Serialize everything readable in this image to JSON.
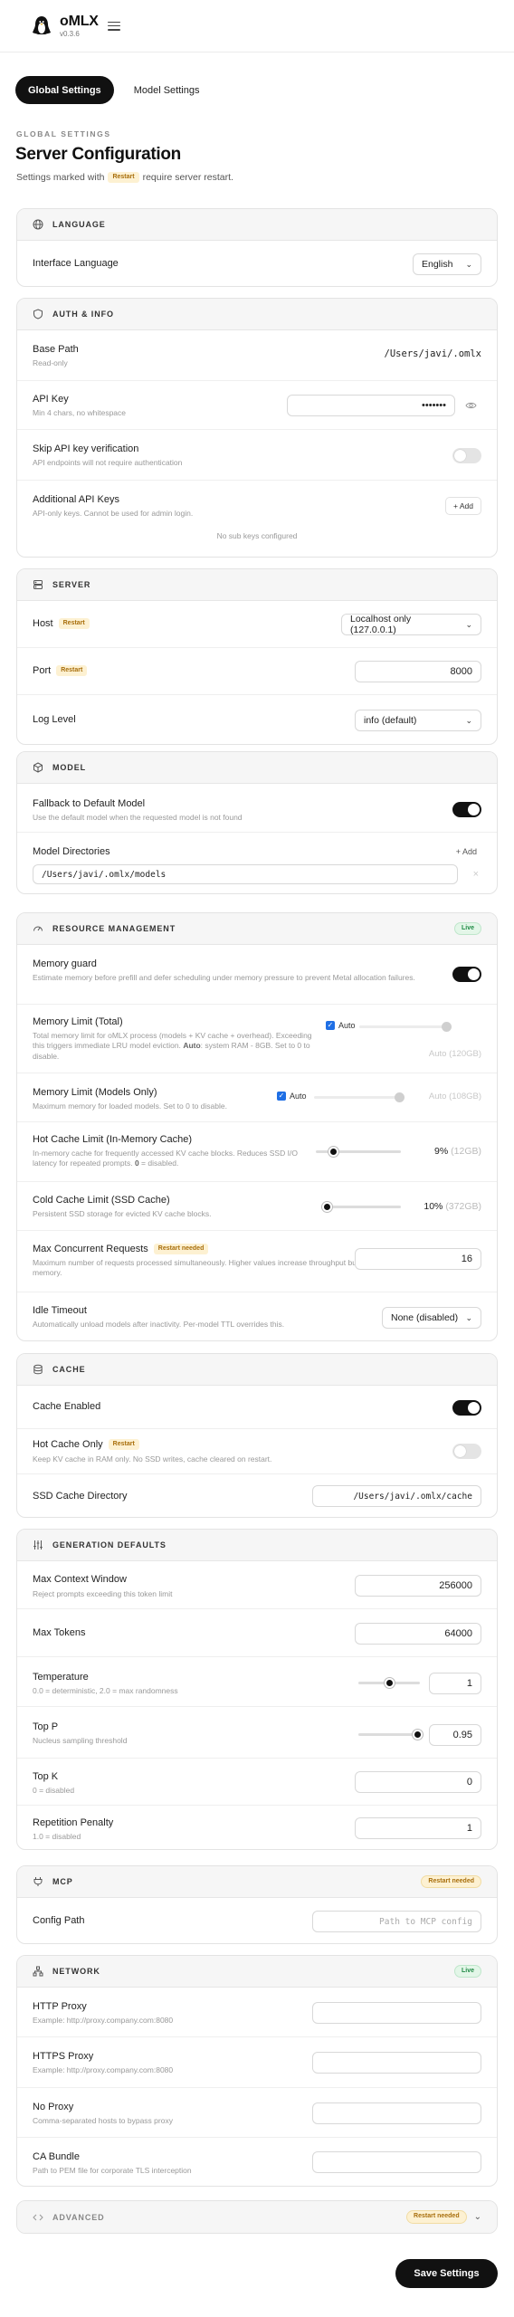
{
  "app": {
    "name": "oMLX",
    "version": "v0.3.6"
  },
  "tabs": [
    {
      "label": "Global Settings",
      "active": true
    },
    {
      "label": "Model Settings",
      "active": false
    }
  ],
  "page": {
    "eyebrow": "GLOBAL SETTINGS",
    "title": "Server Configuration",
    "subtitle_before": "Settings marked with",
    "subtitle_badge": "Restart",
    "subtitle_after": "require server restart."
  },
  "badges": {
    "restart": "Restart",
    "restart_needed": "Restart needed",
    "live": "Live"
  },
  "language": {
    "title": "LANGUAGE",
    "interface_label": "Interface Language",
    "interface_value": "English"
  },
  "auth": {
    "title": "AUTH & INFO",
    "base_path_label": "Base Path",
    "base_path_desc": "Read-only",
    "base_path_value": "/Users/javi/.omlx",
    "api_key_label": "API Key",
    "api_key_desc": "Min 4 chars, no whitespace",
    "api_key_value": "•••••••",
    "skip_label": "Skip API key verification",
    "skip_desc": "API endpoints will not require authentication",
    "skip_on": false,
    "sub_keys_label": "Additional API Keys",
    "sub_keys_desc": "API-only keys. Cannot be used for admin login.",
    "add_button": "+ Add",
    "empty_text": "No sub keys configured"
  },
  "server": {
    "title": "SERVER",
    "host_label": "Host",
    "host_value": "Localhost only (127.0.0.1)",
    "port_label": "Port",
    "port_value": "8000",
    "log_label": "Log Level",
    "log_value": "info (default)"
  },
  "model": {
    "title": "MODEL",
    "fallback_label": "Fallback to Default Model",
    "fallback_desc": "Use the default model when the requested model is not found",
    "fallback_on": true,
    "dirs_label": "Model Directories",
    "add_link": "+ Add",
    "dir_value": "/Users/javi/.omlx/models"
  },
  "resource": {
    "title": "RESOURCE MANAGEMENT",
    "memory_guard_label": "Memory guard",
    "memory_guard_desc": "Estimate memory before prefill and defer scheduling under memory pressure to prevent Metal allocation failures.",
    "memory_guard_on": true,
    "mem_total_label": "Memory Limit (Total)",
    "mem_total_desc_1": "Total memory limit for oMLX process (models + KV cache + overhead).",
    "mem_total_desc_2": "Exceeding this triggers immediate LRU model eviction.",
    "mem_total_desc_auto": "Auto",
    "mem_total_desc_3": ": system RAM - 8GB. Set to 0 to disable.",
    "mem_total_auto_label": "Auto",
    "mem_total_value": "Auto (120GB)",
    "mem_total_level": 0.96,
    "mem_models_label": "Memory Limit (Models Only)",
    "mem_models_desc": "Maximum memory for loaded models. Set to 0 to disable.",
    "mem_models_auto_label": "Auto",
    "mem_models_value": "Auto (108GB)",
    "mem_models_level": 0.96,
    "hot_cache_label": "Hot Cache Limit (In-Memory Cache)",
    "hot_cache_desc_1": "In-memory cache for frequently accessed KV cache blocks.",
    "hot_cache_desc_2": "Reduces SSD I/O latency for repeated prompts.",
    "hot_cache_desc_zero": "0",
    "hot_cache_desc_3": "= disabled.",
    "hot_cache_value": "9%",
    "hot_cache_value_gb": "(12GB)",
    "hot_cache_level": 0.2,
    "cold_cache_label": "Cold Cache Limit (SSD Cache)",
    "cold_cache_desc": "Persistent SSD storage for evicted KV cache blocks.",
    "cold_cache_value": "10%",
    "cold_cache_value_gb": "(372GB)",
    "cold_cache_level": 0.02,
    "max_conc_label": "Max Concurrent Requests",
    "max_conc_desc": "Maximum number of requests processed simultaneously. Higher values increase throughput but use more memory.",
    "max_conc_value": "16",
    "idle_label": "Idle Timeout",
    "idle_desc": "Automatically unload models after inactivity. Per-model TTL overrides this.",
    "idle_value": "None (disabled)"
  },
  "cache": {
    "title": "CACHE",
    "enabled_label": "Cache Enabled",
    "enabled_on": true,
    "hot_only_label": "Hot Cache Only",
    "hot_only_desc": "Keep KV cache in RAM only. No SSD writes, cache cleared on restart.",
    "hot_only_on": false,
    "ssd_dir_label": "SSD Cache Directory",
    "ssd_dir_value": "/Users/javi/.omlx/cache"
  },
  "generation": {
    "title": "GENERATION DEFAULTS",
    "max_ctx_label": "Max Context Window",
    "max_ctx_desc": "Reject prompts exceeding this token limit",
    "max_ctx_value": "256000",
    "max_tokens_label": "Max Tokens",
    "max_tokens_value": "64000",
    "temp_label": "Temperature",
    "temp_desc": "0.0 = deterministic, 2.0 = max randomness",
    "temp_value": "1",
    "temp_level": 0.5,
    "top_p_label": "Top P",
    "top_p_desc": "Nucleus sampling threshold",
    "top_p_value": "0.95",
    "top_p_level": 0.95,
    "top_k_label": "Top K",
    "top_k_desc": "0 = disabled",
    "top_k_value": "0",
    "rep_label": "Repetition Penalty",
    "rep_desc": "1.0 = disabled",
    "rep_value": "1"
  },
  "mcp": {
    "title": "MCP",
    "config_label": "Config Path",
    "config_placeholder": "Path to MCP config"
  },
  "network": {
    "title": "NETWORK",
    "http_label": "HTTP Proxy",
    "http_desc": "Example: http://proxy.company.com:8080",
    "https_label": "HTTPS Proxy",
    "https_desc": "Example: http://proxy.company.com:8080",
    "no_proxy_label": "No Proxy",
    "no_proxy_desc": "Comma-separated hosts to bypass proxy",
    "ca_label": "CA Bundle",
    "ca_desc": "Path to PEM file for corporate TLS interception"
  },
  "advanced": {
    "title": "ADVANCED"
  },
  "save_button": "Save Settings",
  "colors": {
    "primary": "#111111",
    "live": "#1f8a45",
    "restart": "#a86e0b",
    "checkbox": "#1f6fe5"
  }
}
